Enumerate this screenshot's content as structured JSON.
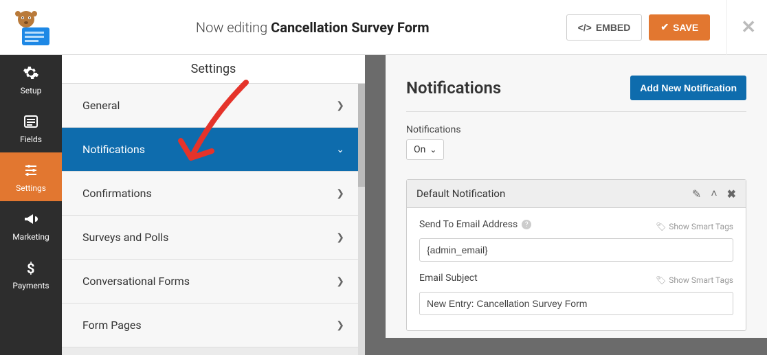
{
  "header": {
    "pre": "Now editing ",
    "title": "Cancellation Survey Form",
    "embed": "EMBED",
    "save": "SAVE"
  },
  "nav": {
    "items": [
      {
        "label": "Setup"
      },
      {
        "label": "Fields"
      },
      {
        "label": "Settings"
      },
      {
        "label": "Marketing"
      },
      {
        "label": "Payments"
      }
    ]
  },
  "panel": {
    "title": "Settings",
    "rows": [
      {
        "label": "General"
      },
      {
        "label": "Notifications"
      },
      {
        "label": "Confirmations"
      },
      {
        "label": "Surveys and Polls"
      },
      {
        "label": "Conversational Forms"
      },
      {
        "label": "Form Pages"
      }
    ]
  },
  "content": {
    "heading": "Notifications",
    "add_btn": "Add New Notification",
    "toggle_label": "Notifications",
    "toggle_value": "On",
    "card": {
      "title": "Default Notification",
      "field1_label": "Send To Email Address",
      "field1_value": "{admin_email}",
      "field2_label": "Email Subject",
      "field2_value": "New Entry: Cancellation Survey Form",
      "smart_tags": "Show Smart Tags"
    }
  }
}
